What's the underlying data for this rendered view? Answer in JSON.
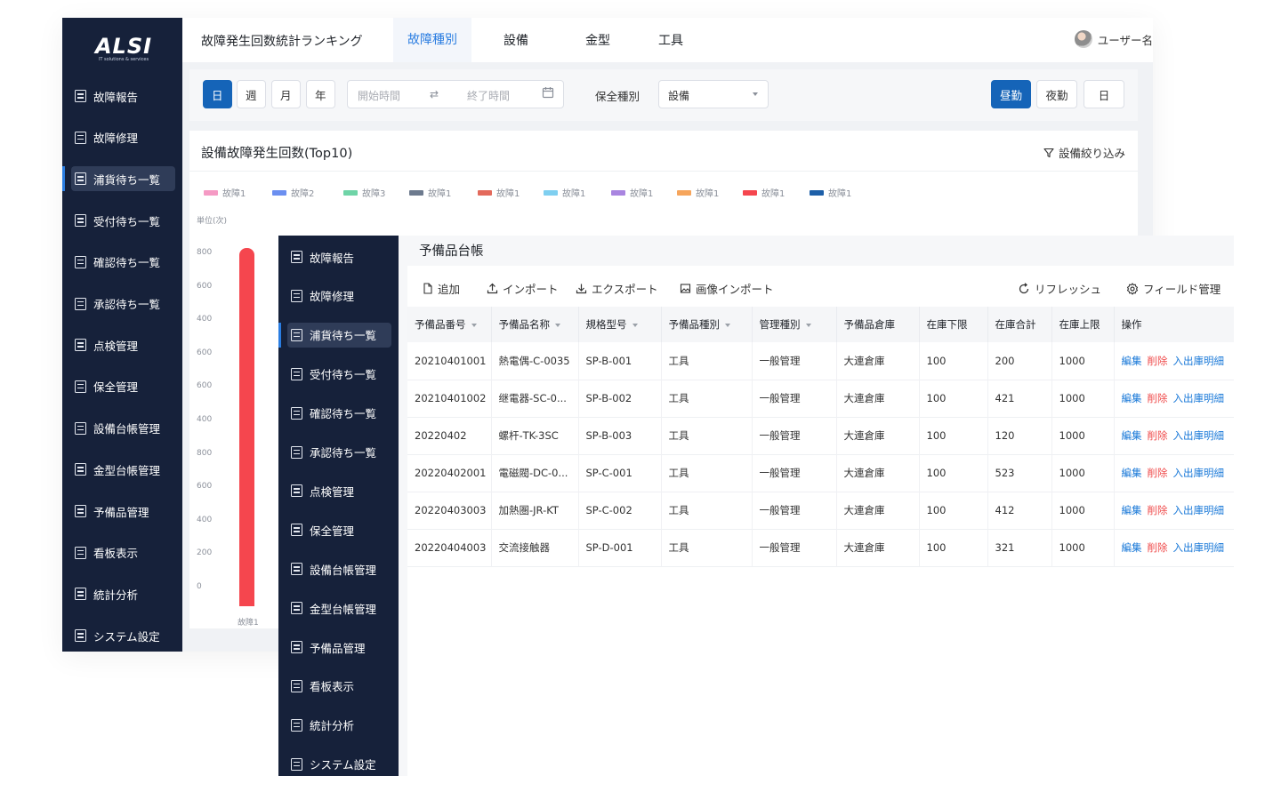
{
  "back": {
    "logo": {
      "main": "ALSI",
      "sub": "IT solutions & services"
    },
    "sidebar": [
      {
        "label": "故障報告",
        "active": false
      },
      {
        "label": "故障修理",
        "active": false
      },
      {
        "label": "浦貨待ち一覧",
        "active": true
      },
      {
        "label": "受付待ち一覧",
        "active": false
      },
      {
        "label": "確認待ち一覧",
        "active": false
      },
      {
        "label": "承認待ち一覧",
        "active": false
      },
      {
        "label": "点検管理",
        "active": false
      },
      {
        "label": "保全管理",
        "active": false
      },
      {
        "label": "設備台帳管理",
        "active": false
      },
      {
        "label": "金型台帳管理",
        "active": false
      },
      {
        "label": "予備品管理",
        "active": false
      },
      {
        "label": "看板表示",
        "active": false
      },
      {
        "label": "統計分析",
        "active": false
      },
      {
        "label": "システム設定",
        "active": false
      }
    ],
    "topbar": {
      "title": "故障発生回数統計ランキング",
      "tabs": [
        "故障種別",
        "設備",
        "金型",
        "工具"
      ],
      "active_tab": "故障種別",
      "user": "ユーザー名"
    },
    "filters": {
      "periods": [
        "日",
        "週",
        "月",
        "年"
      ],
      "active_period": "日",
      "start_placeholder": "開始時間",
      "end_placeholder": "終了時間",
      "type_label": "保全種別",
      "type_value": "設備",
      "shifts": [
        "昼勤",
        "夜勤",
        "日"
      ],
      "active_shift": "昼勤"
    },
    "chart_card": {
      "title": "設備故障発生回数(Top10)",
      "filter_label": "設備絞り込み",
      "unit": "単位(次)"
    }
  },
  "chart_data": {
    "type": "bar",
    "title": "設備故障発生回数(Top10)",
    "ylabel": "単位(次)",
    "y_tick_labels": [
      "800",
      "600",
      "400",
      "600",
      "600",
      "400",
      "800",
      "600",
      "400",
      "200",
      "0"
    ],
    "legend": [
      {
        "name": "故障1",
        "color": "#f59ac4"
      },
      {
        "name": "故障2",
        "color": "#6b8ff0"
      },
      {
        "name": "故障3",
        "color": "#6fd4a7"
      },
      {
        "name": "故障1",
        "color": "#6d7a8e"
      },
      {
        "name": "故障1",
        "color": "#e36a5c"
      },
      {
        "name": "故障1",
        "color": "#7fcff0"
      },
      {
        "name": "故障1",
        "color": "#a985e0"
      },
      {
        "name": "故障1",
        "color": "#f6a55c"
      },
      {
        "name": "故障1",
        "color": "#f5464e"
      },
      {
        "name": "故障1",
        "color": "#1d5fa8"
      }
    ],
    "categories": [
      "故障1"
    ],
    "series": [
      {
        "name": "故障1",
        "values": [
          800
        ],
        "color": "#f5464e"
      }
    ],
    "ylim": [
      0,
      800
    ],
    "grid": false
  },
  "front": {
    "sidebar": [
      {
        "label": "故障報告",
        "active": false
      },
      {
        "label": "故障修理",
        "active": false
      },
      {
        "label": "浦貨待ち一覧",
        "active": true
      },
      {
        "label": "受付待ち一覧",
        "active": false
      },
      {
        "label": "確認待ち一覧",
        "active": false
      },
      {
        "label": "承認待ち一覧",
        "active": false
      },
      {
        "label": "点検管理",
        "active": false
      },
      {
        "label": "保全管理",
        "active": false
      },
      {
        "label": "設備台帳管理",
        "active": false
      },
      {
        "label": "金型台帳管理",
        "active": false
      },
      {
        "label": "予備品管理",
        "active": false
      },
      {
        "label": "看板表示",
        "active": false
      },
      {
        "label": "統計分析",
        "active": false
      },
      {
        "label": "システム設定",
        "active": false
      }
    ],
    "title": "予備品台帳",
    "toolbar": {
      "add": "追加",
      "import": "インポート",
      "export": "エクスポート",
      "image_import": "画像インポート",
      "refresh": "リフレッシュ",
      "fields": "フィールド管理"
    },
    "table": {
      "columns": [
        "予備品番号",
        "予備品名称",
        "規格型号",
        "予備品種別",
        "管理種別",
        "予備品倉庫",
        "在庫下限",
        "在庫合計",
        "在庫上限",
        "操作"
      ],
      "sortable": [
        true,
        true,
        true,
        true,
        true,
        false,
        false,
        false,
        false,
        false
      ],
      "actions": {
        "edit": "編集",
        "delete": "削除",
        "detail": "入出庫明細"
      },
      "rows": [
        [
          "20210401001",
          "熱電偶-C-0035",
          "SP-B-001",
          "工具",
          "一般管理",
          "大連倉庫",
          "100",
          "200",
          "1000"
        ],
        [
          "20210401002",
          "继電器-SC-0...",
          "SP-B-002",
          "工具",
          "一般管理",
          "大連倉庫",
          "100",
          "421",
          "1000"
        ],
        [
          "20220402",
          "螺杆-TK-3SC",
          "SP-B-003",
          "工具",
          "一般管理",
          "大連倉庫",
          "100",
          "120",
          "1000"
        ],
        [
          "20220402001",
          "電磁閥-DC-0...",
          "SP-C-001",
          "工具",
          "一般管理",
          "大連倉庫",
          "100",
          "523",
          "1000"
        ],
        [
          "20220403003",
          "加熱圏-JR-KT",
          "SP-C-002",
          "工具",
          "一般管理",
          "大連倉庫",
          "100",
          "412",
          "1000"
        ],
        [
          "20220404003",
          "交流接触器",
          "SP-D-001",
          "工具",
          "一般管理",
          "大連倉庫",
          "100",
          "321",
          "1000"
        ]
      ]
    }
  }
}
